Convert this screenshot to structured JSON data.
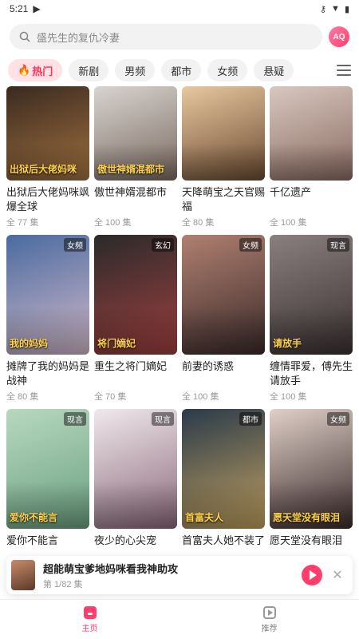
{
  "status_bar": {
    "time": "5:21"
  },
  "search": {
    "placeholder": "盛先生的复仇冷妻"
  },
  "tabs": [
    {
      "label": "热门",
      "active": true
    },
    {
      "label": "新剧"
    },
    {
      "label": "男频"
    },
    {
      "label": "都市"
    },
    {
      "label": "女频"
    },
    {
      "label": "悬疑"
    }
  ],
  "cards": [
    {
      "title": "出狱后大佬妈咪飒爆全球",
      "count": "全 77 集",
      "badge": "",
      "cover_text": "出狱后大佬妈咪",
      "colors": [
        "#3a2a20",
        "#a07040"
      ]
    },
    {
      "title": "傲世神婿混都市",
      "count": "全 100 集",
      "badge": "",
      "cover_text": "傲世神婿混都市",
      "colors": [
        "#d8d4d0",
        "#7a6a60"
      ]
    },
    {
      "title": "天降萌宝之天官赐福",
      "count": "全 80 集",
      "badge": "",
      "cover_text": "",
      "colors": [
        "#e8c8a0",
        "#6a4a30"
      ]
    },
    {
      "title": "千亿遗产",
      "count": "全 100 集",
      "badge": "",
      "cover_text": "",
      "colors": [
        "#d8c8c0",
        "#8a6a60"
      ]
    },
    {
      "title": "摊牌了我的妈妈是战神",
      "count": "全 80 集",
      "badge": "女频",
      "cover_text": "我的妈妈",
      "colors": [
        "#4a6aa0",
        "#d0b8c8"
      ]
    },
    {
      "title": "重生之将门嫡妃",
      "count": "全 70 集",
      "badge": "玄幻",
      "cover_text": "将门嫡妃",
      "colors": [
        "#2a2a2a",
        "#a04040"
      ]
    },
    {
      "title": "前妻的诱惑",
      "count": "全 100 集",
      "badge": "女频",
      "cover_text": "",
      "colors": [
        "#b08070",
        "#3a2a2a"
      ]
    },
    {
      "title": "缠情罪爱，傅先生请放手",
      "count": "全 100 集",
      "badge": "现言",
      "cover_text": "请放手",
      "colors": [
        "#8a8080",
        "#3a3030"
      ]
    },
    {
      "title": "爱你不能言",
      "count": "",
      "badge": "现言",
      "cover_text": "爱你不能言",
      "colors": [
        "#b8d8c0",
        "#6aa080"
      ]
    },
    {
      "title": "夜少的心尖宠",
      "count": "",
      "badge": "现言",
      "cover_text": "",
      "colors": [
        "#f0e8ec",
        "#8a6a7a"
      ]
    },
    {
      "title": "首富夫人她不装了",
      "count": "",
      "badge": "都市",
      "cover_text": "首富夫人",
      "colors": [
        "#2a3a4a",
        "#c0a060"
      ]
    },
    {
      "title": "愿天堂没有眼泪",
      "count": "",
      "badge": "女频",
      "cover_text": "愿天堂没有眼泪",
      "colors": [
        "#e0d0c8",
        "#3a2a2a"
      ]
    }
  ],
  "player": {
    "title": "超能萌宝爹地妈咪看我神助攻",
    "subtitle": "第 1/82 集"
  },
  "nav": {
    "home": "主页",
    "recommend": "推荐"
  },
  "colors": {
    "accent": "#ff3e6c",
    "tab_active_bg": "#ffe1e6"
  }
}
